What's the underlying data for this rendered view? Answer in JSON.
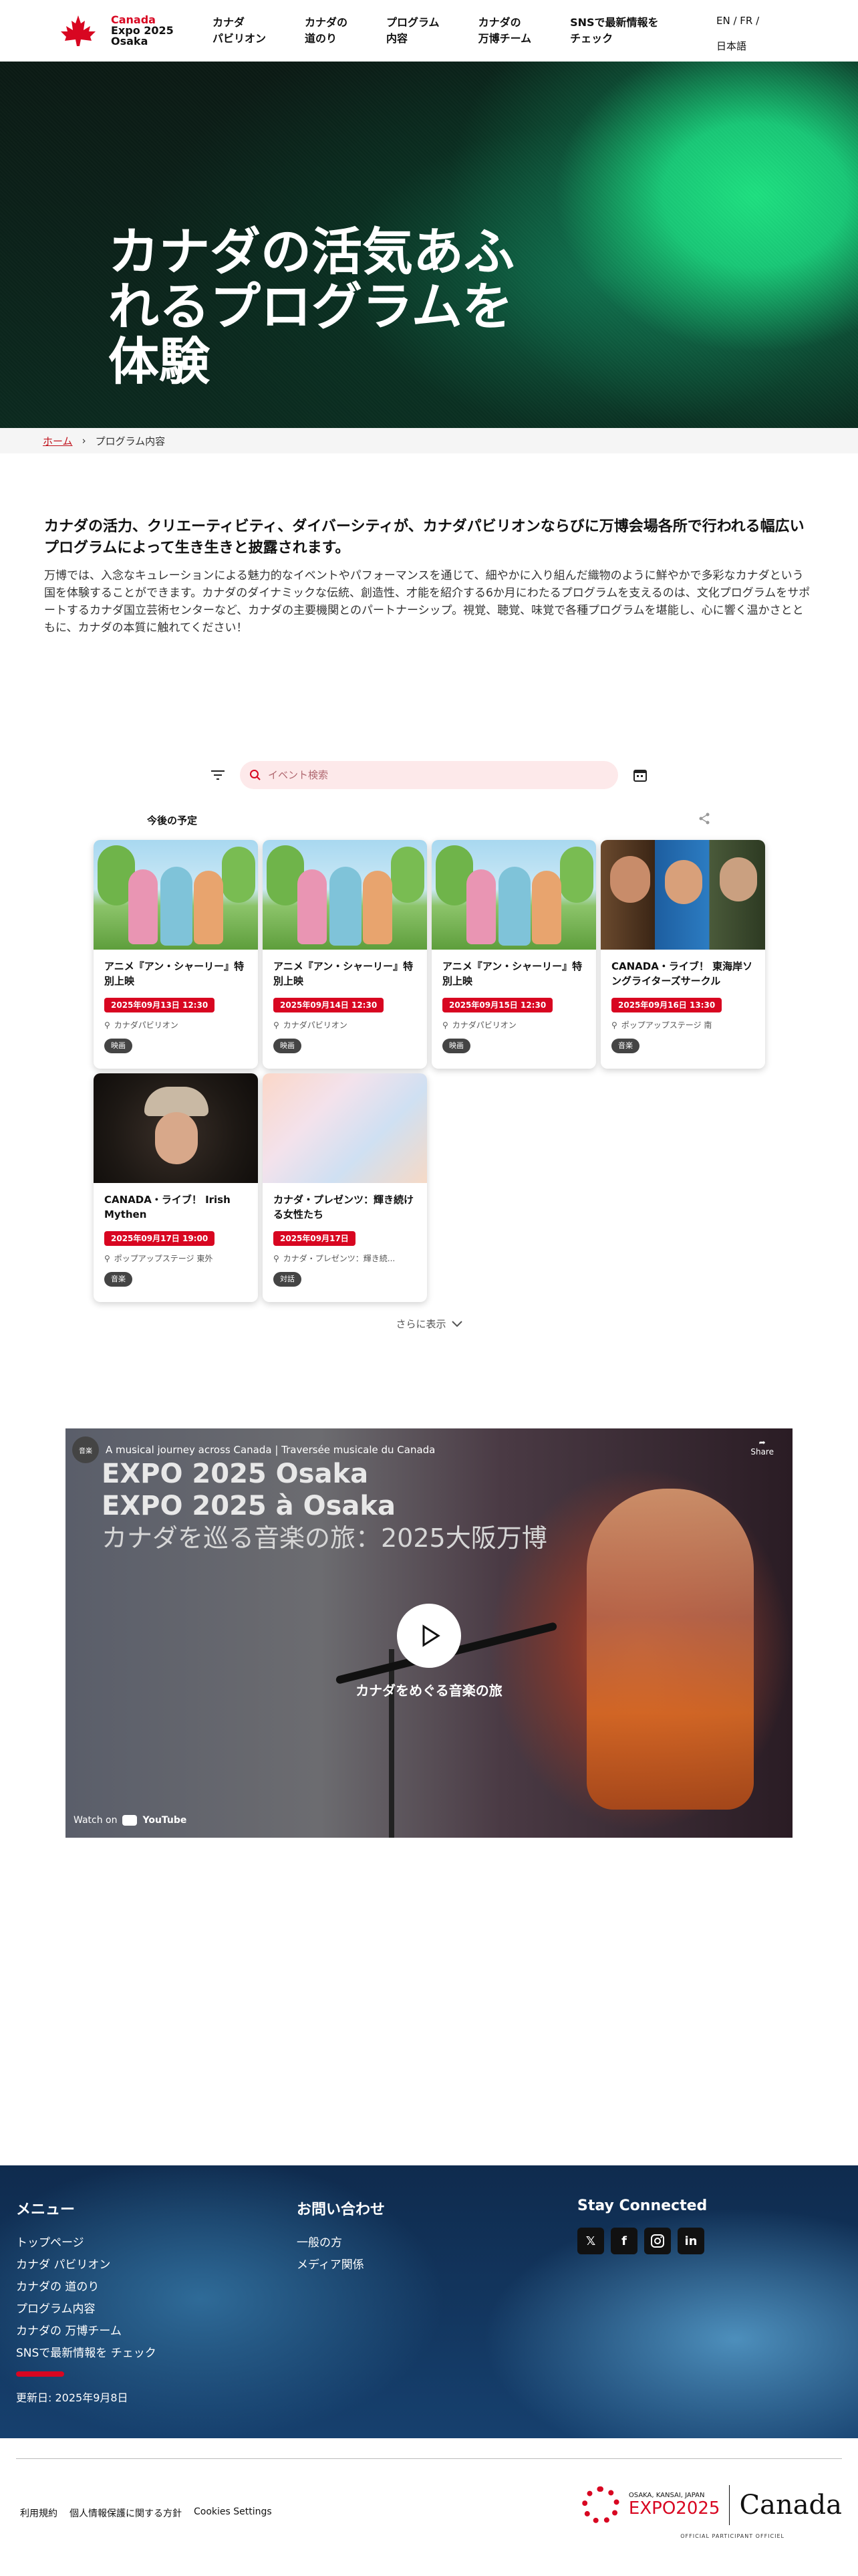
{
  "header": {
    "logo_line1": "Canada",
    "logo_line2": "Expo 2025",
    "logo_line3": "Osaka",
    "nav": [
      {
        "label": "カナダ\nパビリオン"
      },
      {
        "label": "カナダの\n道のり"
      },
      {
        "label": "プログラム\n内容"
      },
      {
        "label": "カナダの\n万博チーム"
      },
      {
        "label": "SNSで最新情報を\nチェック"
      }
    ],
    "lang_en": "EN",
    "lang_fr": "FR",
    "lang_ja": "日本語"
  },
  "hero": {
    "title": "カナダの活気あふれるプログラムを体験"
  },
  "breadcrumb": {
    "home": "ホーム",
    "current": "プログラム内容"
  },
  "intro": {
    "heading": "カナダの活力、クリエーティビティ、ダイバーシティが、カナダパビリオンならびに万博会場各所で行われる幅広いプログラムによって生き生きと披露されます。",
    "body": "万博では、入念なキュレーションによる魅力的なイベントやパフォーマンスを通じて、細やかに入り組んだ織物のように鮮やかで多彩なカナダという国を体験することができます。カナダのダイナミックな伝統、創造性、才能を紹介する6か月にわたるプログラムを支えるのは、文化プログラムをサポートするカナダ国立芸術センターなど、カナダの主要機関とのパートナーシップ。視覚、聴覚、味覚で各種プログラムを堪能し、心に響く温かさとともに、カナダの本質に触れてください！"
  },
  "search": {
    "placeholder": "イベント検索"
  },
  "schedule": {
    "title": "今後の予定",
    "events": [
      {
        "title": "アニメ『アン・シャーリー』特別上映",
        "date": "2025年09月13日 12:30",
        "location": "カナダパビリオン",
        "tag": "映画",
        "image": "anne"
      },
      {
        "title": "アニメ『アン・シャーリー』特別上映",
        "date": "2025年09月14日 12:30",
        "location": "カナダパビリオン",
        "tag": "映画",
        "image": "anne"
      },
      {
        "title": "アニメ『アン・シャーリー』特別上映",
        "date": "2025年09月15日 12:30",
        "location": "カナダパビリオン",
        "tag": "映画",
        "image": "anne"
      },
      {
        "title": "CANADA・ライブ！ 東海岸ソングライターズサークル",
        "date": "2025年09月16日 13:30",
        "location": "ポップアップステージ 南",
        "tag": "音楽",
        "image": "music"
      },
      {
        "title": "CANADA・ライブ！ Irish Mythen",
        "date": "2025年09月17日 19:00",
        "location": "ポップアップステージ 東外",
        "tag": "音楽",
        "image": "irish"
      },
      {
        "title": "カナダ・プレゼンツ：輝き続ける女性たち",
        "date": "2025年09月17日",
        "location": "カナダ・プレゼンツ：輝き続...",
        "tag": "対話",
        "image": "pastel"
      }
    ],
    "more": "さらに表示"
  },
  "video": {
    "channel_title": "A musical journey across Canada | Traversée musicale du Canada",
    "avatar_label": "音楽",
    "share": "Share",
    "line1": "EXPO 2025 Osaka",
    "line2": "EXPO 2025 à Osaka",
    "line3": "カナダを巡る音楽の旅：2025大阪万博",
    "caption": "カナダをめぐる音楽の旅",
    "watch_on": "Watch on",
    "youtube": "YouTube"
  },
  "footer": {
    "menu_title": "メニュー",
    "menu": [
      "トップページ",
      "カナダ パビリオン",
      "カナダの 道のり",
      "プログラム内容",
      "カナダの 万博チーム",
      "SNSで最新情報を チェック"
    ],
    "contact_title": "お問い合わせ",
    "contact": [
      "一般の方",
      "メディア関係"
    ],
    "social_title": "Stay Connected",
    "updated": "更新日: 2025年9月8日",
    "links": [
      "利用規約",
      "個人情報保護に関する方針",
      "Cookies Settings"
    ],
    "expo_small": "OSAKA, KANSAI, JAPAN",
    "expo_label": "EXPO2025",
    "canada_wordmark": "Canada",
    "official": "OFFICIAL PARTICIPANT OFFICIEL"
  },
  "colors": {
    "accent": "#d80621",
    "hero_green": "#1ee080",
    "footer_blue": "#16406e"
  }
}
